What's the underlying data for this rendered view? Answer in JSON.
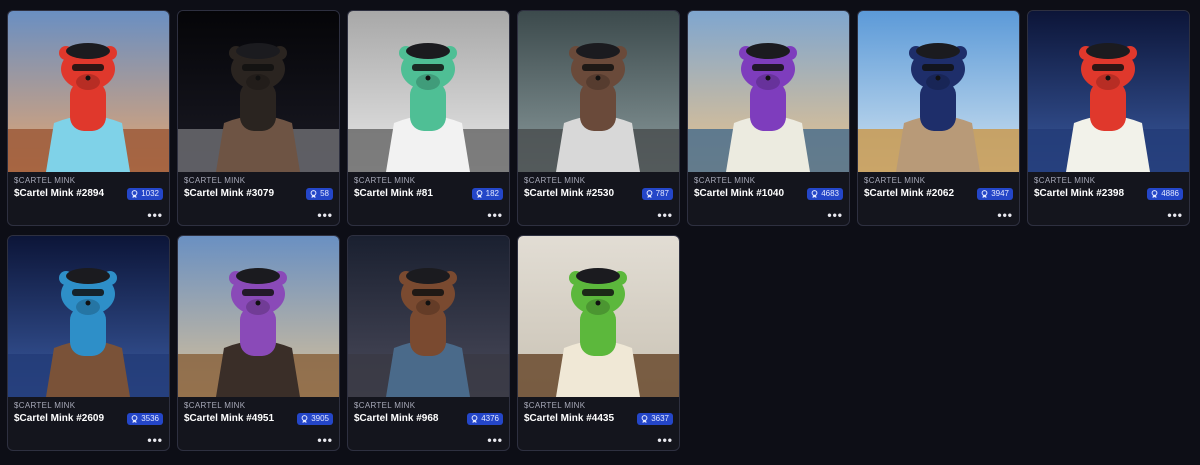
{
  "collection_label": "$CARTEL MINK",
  "cards": [
    {
      "title": "$Cartel Mink #2894",
      "rank": "1032",
      "bg": [
        "#6a8fc2",
        "#e4a570"
      ],
      "ground": "#9c5a3a",
      "fur": "#e0382c",
      "outfit": "#7fd2e8"
    },
    {
      "title": "$Cartel Mink #3079",
      "rank": "58",
      "bg": [
        "#050508",
        "#1a1a24"
      ],
      "ground": "#6b6b70",
      "fur": "#2a2420",
      "outfit": "#6e5444"
    },
    {
      "title": "$Cartel Mink #81",
      "rank": "182",
      "bg": [
        "#a8a8a8",
        "#e8e8e8"
      ],
      "ground": "#6a6a6a",
      "fur": "#4fbf95",
      "outfit": "#f2f2f2"
    },
    {
      "title": "$Cartel Mink #2530",
      "rank": "787",
      "bg": [
        "#3c4a4c",
        "#8a9a9c"
      ],
      "ground": "#4a4f50",
      "fur": "#6a4a3a",
      "outfit": "#d8d8d8"
    },
    {
      "title": "$Cartel Mink #1040",
      "rank": "4683",
      "bg": [
        "#7fa6cf",
        "#eac38c"
      ],
      "ground": "#4b6e8c",
      "fur": "#7e3dbd",
      "outfit": "#ecebe0"
    },
    {
      "title": "$Cartel Mink #2062",
      "rank": "3947",
      "bg": [
        "#5c9ad8",
        "#cfe2f0"
      ],
      "ground": "#c99a50",
      "fur": "#1e2e6a",
      "outfit": "#b89a78"
    },
    {
      "title": "$Cartel Mink #2398",
      "rank": "4886",
      "bg": [
        "#0c1538",
        "#3a5aa0"
      ],
      "ground": "#233c78",
      "fur": "#e0382c",
      "outfit": "#f2f2ea"
    },
    {
      "title": "$Cartel Mink #2609",
      "rank": "3536",
      "bg": [
        "#0c1538",
        "#3a5aa0"
      ],
      "ground": "#233c78",
      "fur": "#2e8fc8",
      "outfit": "#7a5238"
    },
    {
      "title": "$Cartel Mink #4951",
      "rank": "3905",
      "bg": [
        "#6a90c2",
        "#d6c09a"
      ],
      "ground": "#8a6440",
      "fur": "#8a4ab8",
      "outfit": "#3a2e28"
    },
    {
      "title": "$Cartel Mink #968",
      "rank": "4376",
      "bg": [
        "#1a2030",
        "#4a4a5a"
      ],
      "ground": "#3a3a44",
      "fur": "#7a4a30",
      "outfit": "#4a6a8a"
    },
    {
      "title": "$Cartel Mink #4435",
      "rank": "3637",
      "bg": [
        "#e2ddd4",
        "#c9c2b4"
      ],
      "ground": "#6a4a2e",
      "fur": "#5cb83c",
      "outfit": "#f0e8d6"
    }
  ],
  "more_label": "•••"
}
